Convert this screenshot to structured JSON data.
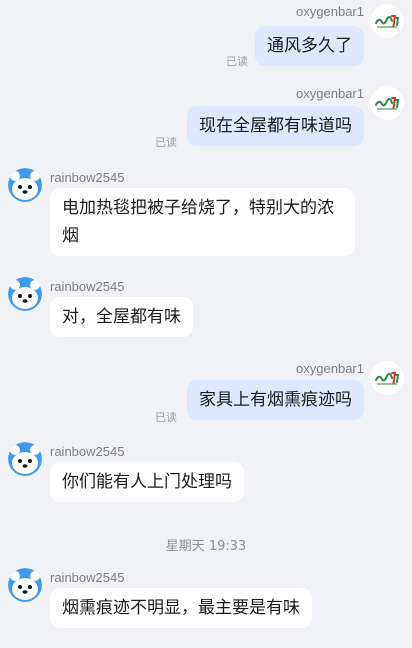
{
  "messages": [
    {
      "side": "out",
      "sender": "oxygenbar1",
      "text": "通风多久了",
      "status": "已读"
    },
    {
      "side": "out",
      "sender": "oxygenbar1",
      "text": "现在全屋都有味道吗",
      "status": "已读"
    },
    {
      "side": "in",
      "sender": "rainbow2545",
      "text": "电加热毯把被子给烧了，特别大的浓烟"
    },
    {
      "side": "in",
      "sender": "rainbow2545",
      "text": "对，全屋都有味"
    },
    {
      "side": "out",
      "sender": "oxygenbar1",
      "text": "家具上有烟熏痕迹吗",
      "status": "已读"
    },
    {
      "side": "in",
      "sender": "rainbow2545",
      "text": "你们能有人上门处理吗"
    },
    {
      "side": "in",
      "sender": "rainbow2545",
      "text": "烟熏痕迹不明显，最主要是有味"
    }
  ],
  "time_divider": "星期天 19:33",
  "colors": {
    "background": "#f1f2f6",
    "outgoing_bubble": "#dde8ff",
    "incoming_bubble": "#ffffff",
    "agent_avatar_accent": "#2d8a3e",
    "user_avatar_accent": "#3f9bea"
  },
  "icons": {
    "agent_avatar": "oxygenbar-logo-icon",
    "user_avatar": "bear-avatar-icon"
  }
}
